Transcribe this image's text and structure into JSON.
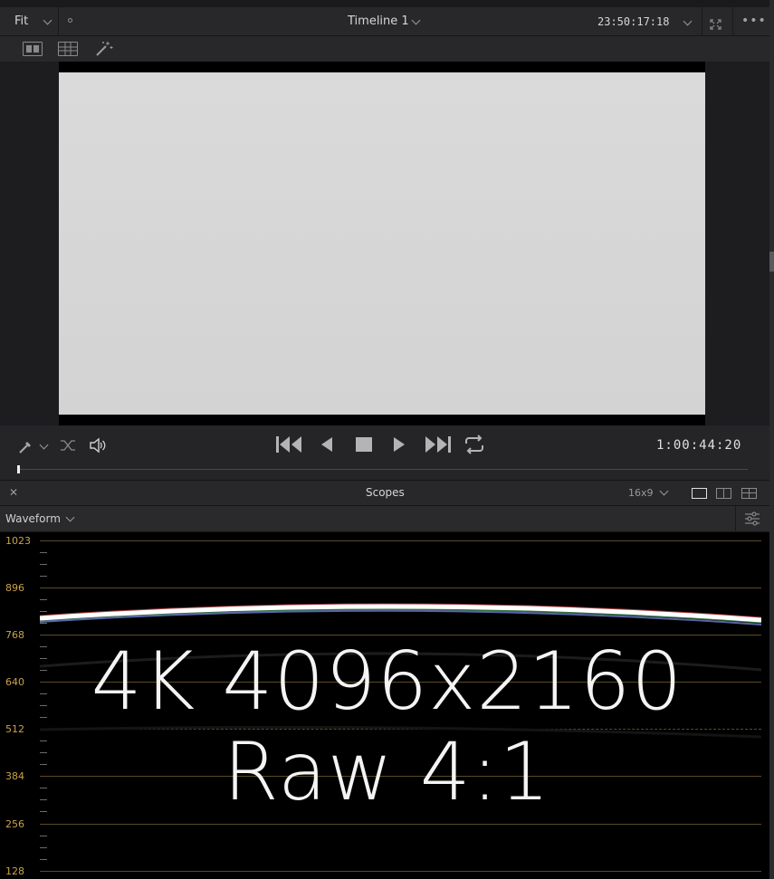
{
  "topbar": {
    "zoom_label": "Fit",
    "timeline_name": "Timeline 1",
    "source_timecode": "23:50:17:18"
  },
  "transport": {
    "timecode": "1:00:44:20",
    "playhead_position": 0.0
  },
  "scopes": {
    "panel_title": "Scopes",
    "aspect": "16x9",
    "scope_type": "Waveform",
    "y_labels": [
      "1023",
      "896",
      "768",
      "640",
      "512",
      "384",
      "256",
      "128"
    ]
  },
  "overlay_text": {
    "line1": "4K 4096x2160",
    "line2": "Raw 4:1"
  },
  "colors": {
    "accent_scale": "#c9a24a",
    "background": "#1f1f21"
  }
}
